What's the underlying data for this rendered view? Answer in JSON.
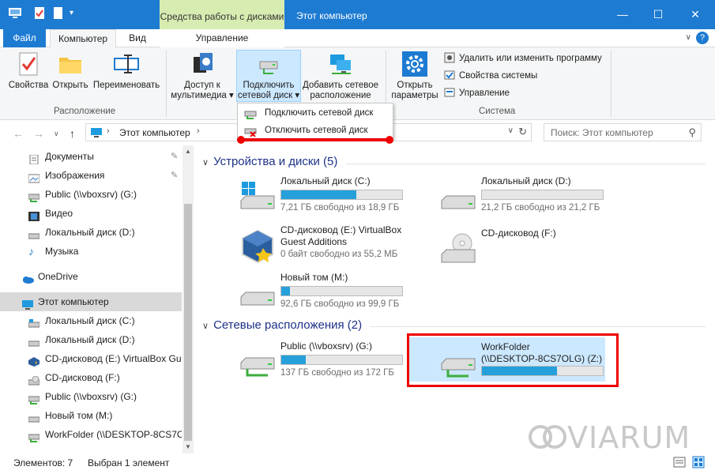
{
  "window": {
    "title": "Этот компьютер",
    "context_tab": "Средства работы с дисками",
    "minimize": "—",
    "maximize": "☐",
    "close": "✕"
  },
  "tabs": {
    "file": "Файл",
    "computer": "Компьютер",
    "view": "Вид",
    "manage": "Управление",
    "help": "?"
  },
  "ribbon": {
    "properties": "Свойства",
    "open": "Открыть",
    "rename": "Переименовать",
    "group_location": "Расположение",
    "media_access_1": "Доступ к",
    "media_access_2": "мультимедиа",
    "map_drive_1": "Подключить",
    "map_drive_2": "сетевой диск",
    "add_network_1": "Добавить сетевое",
    "add_network_2": "расположение",
    "open_settings_1": "Открыть",
    "open_settings_2": "параметры",
    "uninstall": "Удалить или изменить программу",
    "system_props": "Свойства системы",
    "manage": "Управление",
    "group_system": "Система"
  },
  "dropdown": {
    "connect": "Подключить сетевой диск",
    "disconnect": "Отключить сетевой диск"
  },
  "address": {
    "path": "Этот компьютер",
    "search_placeholder": "Поиск: Этот компьютер"
  },
  "navpane": {
    "items": [
      {
        "label": "Документы",
        "pinned": true
      },
      {
        "label": "Изображения",
        "pinned": true
      },
      {
        "label": "Public (\\\\vboxsrv) (G:)"
      },
      {
        "label": "Видео"
      },
      {
        "label": "Локальный диск (D:)"
      },
      {
        "label": "Музыка"
      },
      {
        "label": "OneDrive"
      },
      {
        "label": "Этот компьютер"
      },
      {
        "label": "Локальный диск (C:)"
      },
      {
        "label": "Локальный диск (D:)"
      },
      {
        "label": "CD-дисковод (E:) VirtualBox Gue"
      },
      {
        "label": "CD-дисковод (F:)"
      },
      {
        "label": "Public (\\\\vboxsrv) (G:)"
      },
      {
        "label": "Новый том (M:)"
      },
      {
        "label": "WorkFolder (\\\\DESKTOP-8CS7OL"
      }
    ]
  },
  "content": {
    "devices_header": "Устройства и диски (5)",
    "network_header": "Сетевые расположения (2)",
    "drives": [
      {
        "name": "Локальный диск (C:)",
        "free": "7,21 ГБ свободно из 18,9 ГБ",
        "used_fraction": 0.62
      },
      {
        "name": "Локальный диск (D:)",
        "free": "21,2 ГБ свободно из 21,2 ГБ",
        "used_fraction": 0.0
      },
      {
        "name": "CD-дисковод (E:) VirtualBox Guest Additions",
        "free": "0 байт свободно из 55,2 МБ",
        "used_fraction": 1.0
      },
      {
        "name": "CD-дисковод (F:)"
      },
      {
        "name": "Новый том (M:)",
        "free": "92,6 ГБ свободно из 99,9 ГБ",
        "used_fraction": 0.07
      }
    ],
    "network": [
      {
        "name": "Public (\\\\vboxsrv) (G:)",
        "free": "137 ГБ свободно из 172 ГБ",
        "used_fraction": 0.2
      },
      {
        "name_1": "WorkFolder",
        "name_2": "(\\\\DESKTOP-8CS7OLG) (Z:)",
        "used_fraction": 0.62
      }
    ]
  },
  "status": {
    "items": "Элементов: 7",
    "selected": "Выбран 1 элемент"
  },
  "watermark": "VIARUM"
}
